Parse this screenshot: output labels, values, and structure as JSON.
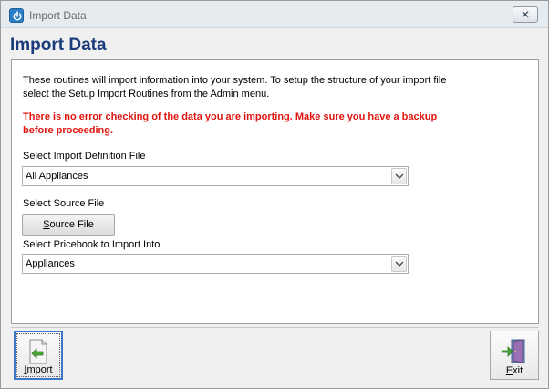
{
  "window": {
    "title": "Import Data",
    "close_label": "✕"
  },
  "heading": "Import Data",
  "description": "These routines will import information into your system.  To setup the structure of your import file select the Setup Import Routines from the Admin menu.",
  "warning": "There is no error checking of the data you are importing.  Make sure you have a backup before proceeding.",
  "definition_file": {
    "label": "Select Import Definition File",
    "selected": "All Appliances"
  },
  "source_file": {
    "label": "Select Source File",
    "button_accel": "S",
    "button_rest": "ource File"
  },
  "pricebook": {
    "label": "Select Pricebook to Import Into",
    "selected": "Appliances"
  },
  "footer": {
    "import_accel": "I",
    "import_rest": "mport",
    "exit_accel": "E",
    "exit_rest": "xit"
  },
  "colors": {
    "heading": "#1a3c7a",
    "warning": "#e0140f",
    "focus_border": "#3b78c8"
  },
  "icons": {
    "app": "power-icon",
    "import": "import-document-icon",
    "exit": "exit-door-icon",
    "dropdown": "chevron-down-icon"
  }
}
